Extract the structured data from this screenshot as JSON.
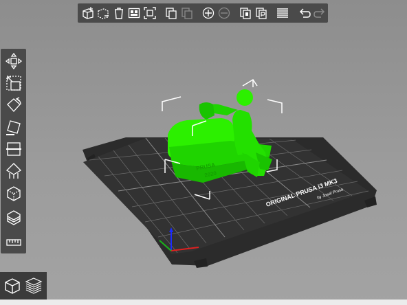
{
  "bed": {
    "brand_text": "ORIGINAL PRUSA i3 MK3",
    "by_text": "by Josef Prusa"
  },
  "model": {
    "plate_text_line1": "PRUSA",
    "plate_text_line2": "2020",
    "color": "#22dd00"
  },
  "colors": {
    "toolbar_bg": "#4a4a4a",
    "icon": "#ffffff",
    "icon_disabled": "#8a8a8a",
    "bed": "#2b2b2b",
    "grid": "#6d6d6d",
    "accent_orange": "#ed6b21"
  },
  "top_toolbar": {
    "buttons": [
      {
        "icon": "add-icon",
        "enabled": true
      },
      {
        "icon": "delete-icon",
        "enabled": true
      },
      {
        "icon": "delete-all-icon",
        "enabled": true
      },
      {
        "icon": "arrange-icon",
        "enabled": true
      },
      {
        "icon": "split-objects-icon",
        "enabled": true
      },
      {
        "icon": "copy-icon",
        "enabled": true
      },
      {
        "icon": "paste-icon",
        "enabled": false
      },
      {
        "icon": "add-instance-icon",
        "enabled": true
      },
      {
        "icon": "remove-instance-icon",
        "enabled": false
      },
      {
        "icon": "split-to-objects-icon",
        "enabled": true
      },
      {
        "icon": "split-to-parts-icon",
        "enabled": true
      },
      {
        "icon": "layers-editing-icon",
        "enabled": true
      },
      {
        "icon": "undo-icon",
        "enabled": true
      },
      {
        "icon": "redo-icon",
        "enabled": false
      }
    ]
  },
  "left_toolbar": {
    "tools": [
      {
        "icon": "move-icon"
      },
      {
        "icon": "scale-icon"
      },
      {
        "icon": "rotate-icon"
      },
      {
        "icon": "place-on-face-icon"
      },
      {
        "icon": "cut-icon"
      },
      {
        "icon": "support-painting-icon"
      },
      {
        "icon": "seam-painting-icon"
      },
      {
        "icon": "variable-layer-height-icon"
      },
      {
        "icon": "measure-icon"
      }
    ]
  },
  "view_switch": {
    "buttons": [
      {
        "icon": "3d-view-icon",
        "active": true
      },
      {
        "icon": "preview-icon",
        "active": false
      }
    ]
  }
}
